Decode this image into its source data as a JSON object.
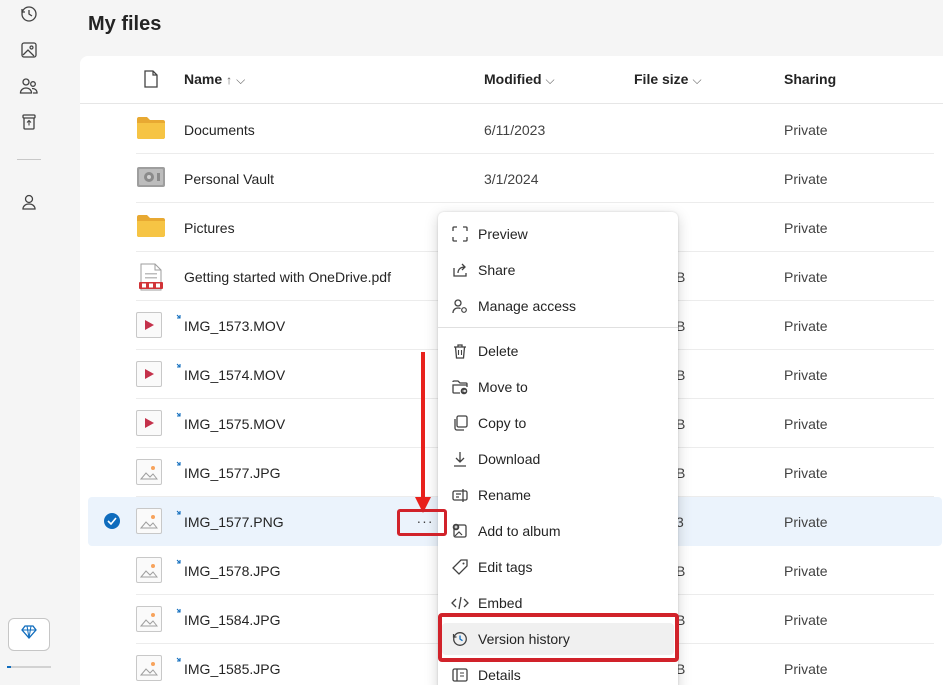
{
  "page": {
    "title": "My files"
  },
  "columns": {
    "name": "Name",
    "name_sort": "↑",
    "modified": "Modified",
    "file_size": "File size",
    "sharing": "Sharing"
  },
  "rows": [
    {
      "name": "Documents",
      "modified": "6/11/2023",
      "size": "",
      "sharing": "Private",
      "type": "folder"
    },
    {
      "name": "Personal Vault",
      "modified": "3/1/2024",
      "size": "",
      "sharing": "Private",
      "type": "vault"
    },
    {
      "name": "Pictures",
      "modified": "",
      "size": "",
      "sharing": "Private",
      "type": "folder"
    },
    {
      "name": "Getting started with OneDrive.pdf",
      "modified": "",
      "size": "B",
      "sharing": "Private",
      "type": "pdf"
    },
    {
      "name": "IMG_1573.MOV",
      "modified": "",
      "size": "B",
      "sharing": "Private",
      "type": "video"
    },
    {
      "name": "IMG_1574.MOV",
      "modified": "",
      "size": "B",
      "sharing": "Private",
      "type": "video"
    },
    {
      "name": "IMG_1575.MOV",
      "modified": "",
      "size": "B",
      "sharing": "Private",
      "type": "video"
    },
    {
      "name": "IMG_1577.JPG",
      "modified": "",
      "size": "B",
      "sharing": "Private",
      "type": "image"
    },
    {
      "name": "IMG_1577.PNG",
      "modified": "",
      "size": "3",
      "sharing": "Private",
      "type": "image",
      "selected": true,
      "more": "···"
    },
    {
      "name": "IMG_1578.JPG",
      "modified": "",
      "size": "B",
      "sharing": "Private",
      "type": "image"
    },
    {
      "name": "IMG_1584.JPG",
      "modified": "",
      "size": "B",
      "sharing": "Private",
      "type": "image"
    },
    {
      "name": "IMG_1585.JPG",
      "modified": "",
      "size": "B",
      "sharing": "Private",
      "type": "image"
    }
  ],
  "menu": {
    "items": [
      {
        "label": "Preview",
        "icon": "preview-icon"
      },
      {
        "label": "Share",
        "icon": "share-icon"
      },
      {
        "label": "Manage access",
        "icon": "manage-access-icon"
      },
      {
        "label": "Delete",
        "icon": "trash-icon"
      },
      {
        "label": "Move to",
        "icon": "move-to-icon"
      },
      {
        "label": "Copy to",
        "icon": "copy-icon"
      },
      {
        "label": "Download",
        "icon": "download-icon"
      },
      {
        "label": "Rename",
        "icon": "rename-icon"
      },
      {
        "label": "Add to album",
        "icon": "add-album-icon"
      },
      {
        "label": "Edit tags",
        "icon": "tag-icon"
      },
      {
        "label": "Embed",
        "icon": "embed-icon"
      },
      {
        "label": "Version history",
        "icon": "history-icon",
        "highlighted": true
      },
      {
        "label": "Details",
        "icon": "details-icon"
      }
    ]
  },
  "colors": {
    "accent": "#0f6cbd",
    "annotation": "#e8211c",
    "folder": "#f6c444",
    "selected_row": "#ebf3fc"
  }
}
